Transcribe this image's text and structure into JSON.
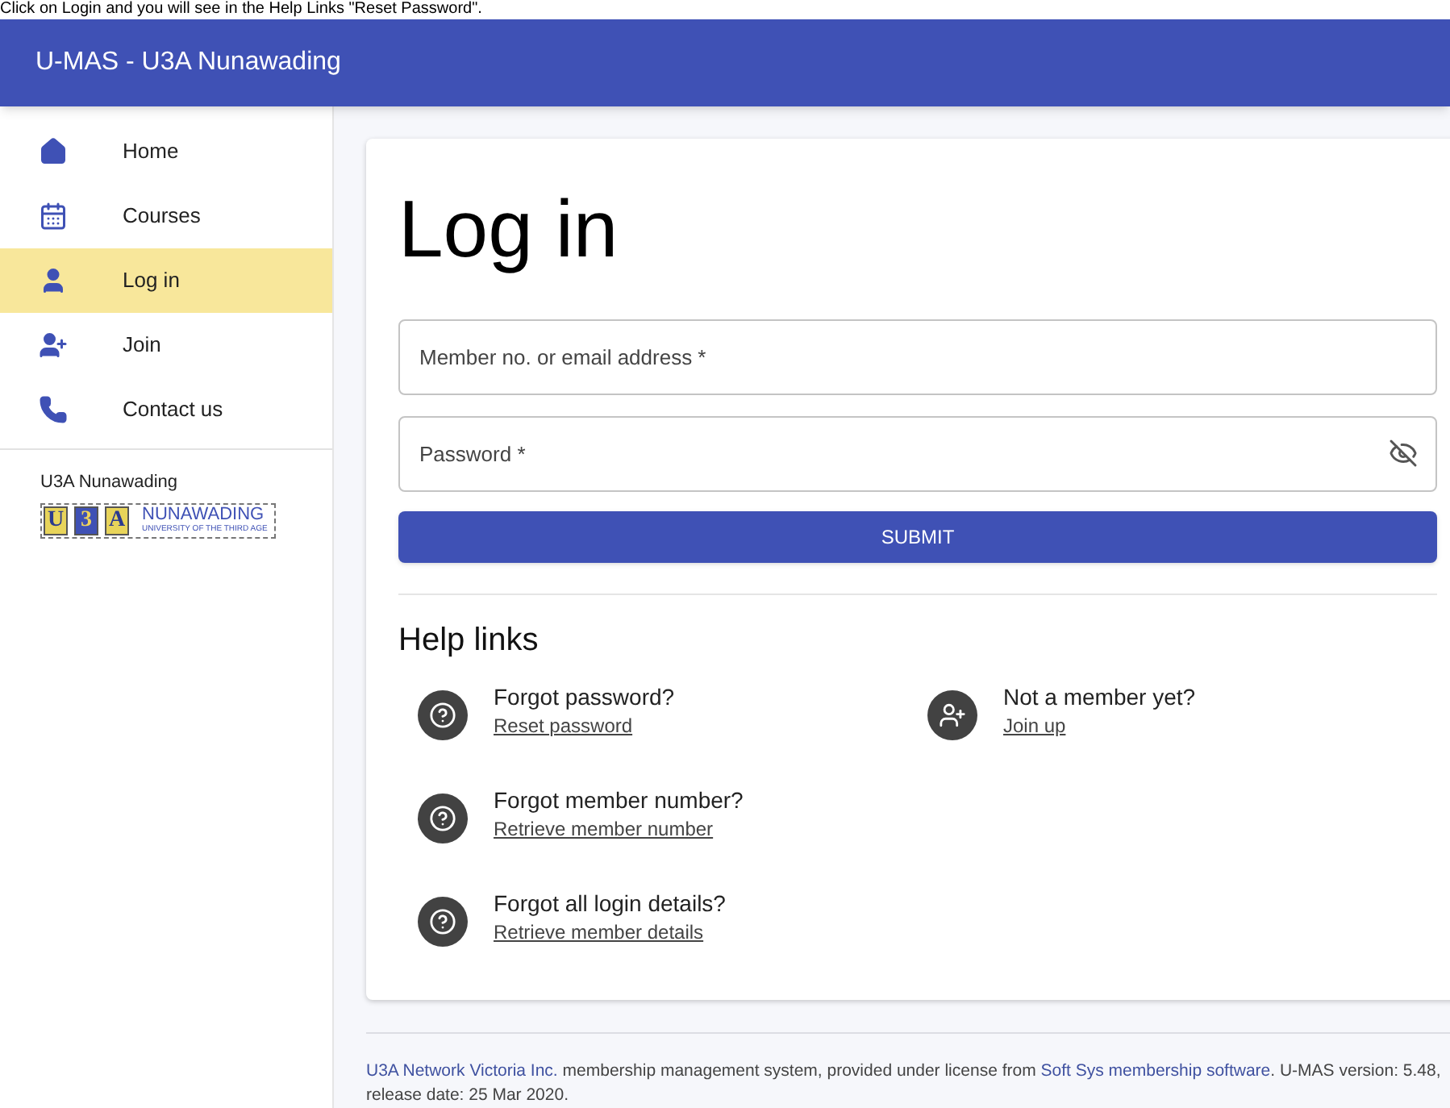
{
  "caption": "Click on Login and you will see in the Help Links \"Reset Password\".",
  "app_bar": {
    "title": "U-MAS - U3A Nunawading"
  },
  "sidebar": {
    "items": [
      {
        "label": "Home",
        "kind": "home",
        "selected": false
      },
      {
        "label": "Courses",
        "kind": "calendar",
        "selected": false
      },
      {
        "label": "Log in",
        "kind": "person",
        "selected": true
      },
      {
        "label": "Join",
        "kind": "person-add",
        "selected": false
      },
      {
        "label": "Contact us",
        "kind": "phone",
        "selected": false
      }
    ],
    "org_name": "U3A Nunawading",
    "logo": {
      "letters": [
        "U",
        "3",
        "A"
      ],
      "name": "NUNAWADING",
      "subtitle": "UNIVERSITY OF THE THIRD AGE"
    }
  },
  "login": {
    "title": "Log in",
    "fields": [
      {
        "placeholder": "Member no. or email address *",
        "kind": "text"
      },
      {
        "placeholder": "Password *",
        "kind": "password"
      }
    ],
    "submit": "SUBMIT"
  },
  "help": {
    "title": "Help links",
    "columns": [
      [
        {
          "question": "Forgot password?",
          "link": "Reset password",
          "kind": "help"
        },
        {
          "question": "Forgot member number?",
          "link": "Retrieve member number",
          "kind": "help"
        },
        {
          "question": "Forgot all login details?",
          "link": "Retrieve member details",
          "kind": "help"
        }
      ],
      [
        {
          "question": "Not a member yet?",
          "link": "Join up",
          "kind": "person-add"
        }
      ]
    ]
  },
  "footer": {
    "parts": [
      {
        "text": "U3A Network Victoria Inc.",
        "kind": "link"
      },
      {
        "text": " membership management system, provided under license from ",
        "kind": "text"
      },
      {
        "text": "Soft Sys membership software",
        "kind": "link"
      },
      {
        "text": ". U-MAS version: 5.48, release date: 25 Mar 2020.",
        "kind": "text"
      }
    ]
  }
}
